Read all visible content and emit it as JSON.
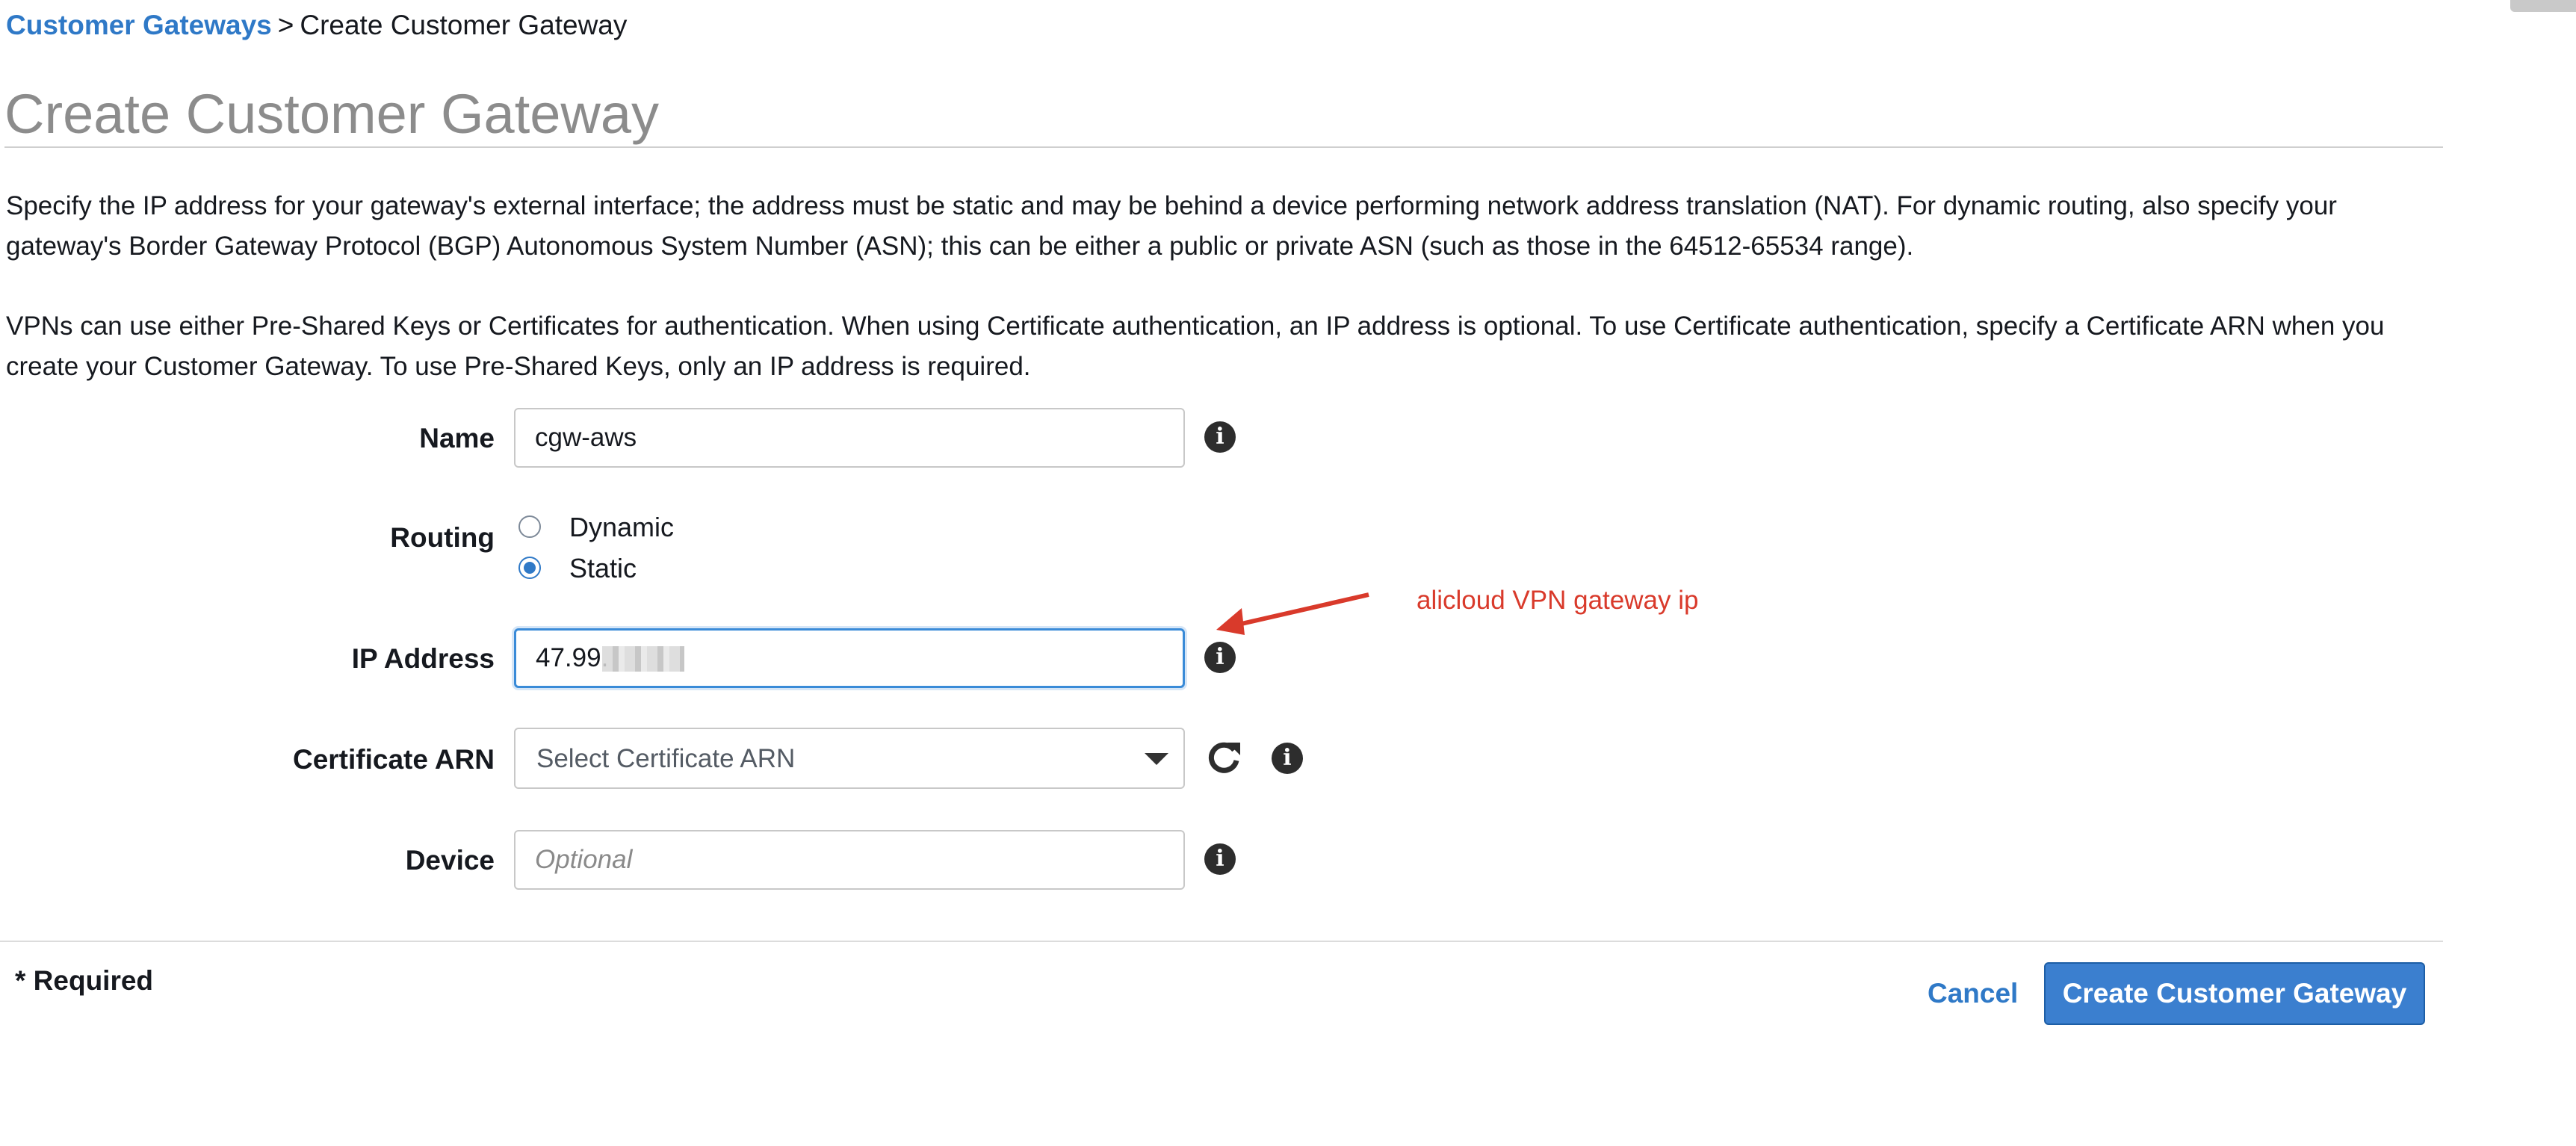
{
  "breadcrumb": {
    "parent_link": "Customer Gateways",
    "separator": ">",
    "current": "Create Customer Gateway"
  },
  "page_title": "Create Customer Gateway",
  "description": {
    "paragraph1": "Specify the IP address for your gateway's external interface; the address must be static and may be behind a device performing network address translation (NAT). For dynamic routing, also specify your gateway's Border Gateway Protocol (BGP) Autonomous System Number (ASN); this can be either a public or private ASN (such as those in the 64512-65534 range).",
    "paragraph2": "VPNs can use either Pre-Shared Keys or Certificates for authentication. When using Certificate authentication, an IP address is optional. To use Certificate authentication, specify a Certificate ARN when you create your Customer Gateway. To use Pre-Shared Keys, only an IP address is required."
  },
  "form": {
    "name": {
      "label": "Name",
      "value": "cgw-aws"
    },
    "routing": {
      "label": "Routing",
      "options": [
        {
          "label": "Dynamic",
          "selected": false
        },
        {
          "label": "Static",
          "selected": true
        }
      ]
    },
    "ip_address": {
      "label": "IP Address",
      "value": "47.99."
    },
    "certificate_arn": {
      "label": "Certificate ARN",
      "placeholder": "Select Certificate ARN"
    },
    "device": {
      "label": "Device",
      "placeholder": "Optional",
      "value": ""
    }
  },
  "annotation": {
    "text": "alicloud VPN gateway ip",
    "color": "#d93a2b"
  },
  "footer": {
    "required_note": "* Required",
    "cancel_label": "Cancel",
    "submit_label": "Create Customer Gateway"
  },
  "icons": {
    "info": "info-icon",
    "refresh": "refresh-icon",
    "dropdown": "chevron-down-icon"
  },
  "colors": {
    "link": "#2f79c7",
    "primary_button": "#3b7fcf",
    "focus_border": "#3a8bd8",
    "title": "#8c8c8c"
  }
}
